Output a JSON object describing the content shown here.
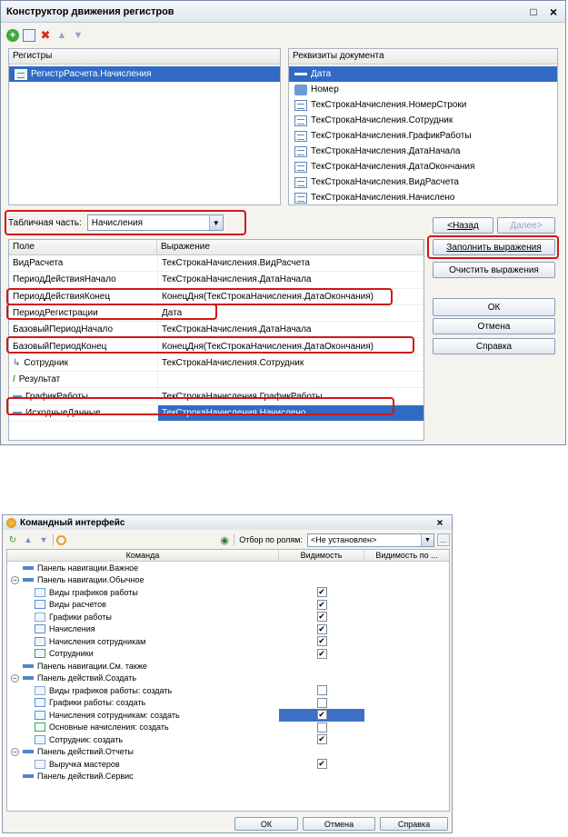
{
  "w1": {
    "title": "Конструктор движения регистров",
    "close_glyph": "×",
    "max_glyph": "□",
    "registers": {
      "header": "Регистры",
      "items": [
        "РегистрРасчета.Начисления"
      ]
    },
    "doc_props": {
      "header": "Реквизиты документа",
      "items": [
        "Дата",
        "Номер",
        "ТекСтрокаНачисления.НомерСтроки",
        "ТекСтрокаНачисления.Сотрудник",
        "ТекСтрокаНачисления.ГрафикРаботы",
        "ТекСтрокаНачисления.ДатаНачала",
        "ТекСтрокаНачисления.ДатаОкончания",
        "ТекСтрокаНачисления.ВидРасчета",
        "ТекСтрокаНачисления.Начислено"
      ]
    },
    "table_part": {
      "label": "Табличная часть:",
      "value": "Начисления"
    },
    "grid": {
      "col_field": "Поле",
      "col_expr": "Выражение",
      "rows": [
        {
          "field": "ВидРасчета",
          "expr": "ТекСтрокаНачисления.ВидРасчета"
        },
        {
          "field": "ПериодДействияНачало",
          "expr": "ТекСтрокаНачисления.ДатаНачала"
        },
        {
          "field": "ПериодДействияКонец",
          "expr": "КонецДня(ТекСтрокаНачисления.ДатаОкончания)"
        },
        {
          "field": "ПериодРегистрации",
          "expr": "Дата"
        },
        {
          "field": "БазовыйПериодНачало",
          "expr": "ТекСтрокаНачисления.ДатаНачала"
        },
        {
          "field": "БазовыйПериодКонец",
          "expr": "КонецДня(ТекСтрокаНачисления.ДатаОкончания)"
        },
        {
          "field": "Сотрудник",
          "expr": "ТекСтрокаНачисления.Сотрудник"
        },
        {
          "field": "Результат",
          "expr": ""
        },
        {
          "field": "ГрафикРаботы",
          "expr": "ТекСтрокаНачисления.ГрафикРаботы"
        },
        {
          "field": "ИсходныеДанные",
          "expr": "ТекСтрокаНачисления.Начислено"
        }
      ]
    },
    "buttons": {
      "back": "<Назад",
      "next": "Далее>",
      "fill": "Заполнить выражения",
      "clear": "Очистить выражения",
      "ok": "ОК",
      "cancel": "Отмена",
      "help": "Справка"
    }
  },
  "w2": {
    "title": "Командный интерфейс",
    "close_glyph": "×",
    "filter_label": "Отбор по ролям:",
    "filter_value": "<Не установлен>",
    "ellipsis": "...",
    "cols": {
      "command": "Команда",
      "visibility": "Видимость",
      "visibility_by": "Видимость по ..."
    },
    "rows": [
      {
        "label": "Панель навигации.Важное",
        "level": 0,
        "toggle": "",
        "check": null
      },
      {
        "label": "Панель навигации.Обычное",
        "level": 0,
        "toggle": "−",
        "check": null
      },
      {
        "label": "Виды графиков работы",
        "level": 1,
        "toggle": "",
        "check": true
      },
      {
        "label": "Виды расчетов",
        "level": 1,
        "toggle": "",
        "check": true
      },
      {
        "label": "Графики работы",
        "level": 1,
        "toggle": "",
        "check": true
      },
      {
        "label": "Начисления",
        "level": 1,
        "toggle": "",
        "check": true
      },
      {
        "label": "Начисления сотрудникам",
        "level": 1,
        "toggle": "",
        "check": true
      },
      {
        "label": "Сотрудники",
        "level": 1,
        "toggle": "",
        "check": true
      },
      {
        "label": "Панель навигации.См. также",
        "level": 0,
        "toggle": "",
        "check": null
      },
      {
        "label": "Панель действий.Создать",
        "level": 0,
        "toggle": "−",
        "check": null
      },
      {
        "label": "Виды графиков работы: создать",
        "level": 1,
        "toggle": "",
        "check": false
      },
      {
        "label": "Графики работы: создать",
        "level": 1,
        "toggle": "",
        "check": false
      },
      {
        "label": "Начисления сотрудникам: создать",
        "level": 1,
        "toggle": "",
        "check": true,
        "selected": true
      },
      {
        "label": "Основные начисления: создать",
        "level": 1,
        "toggle": "",
        "check": false
      },
      {
        "label": "Сотрудник: создать",
        "level": 1,
        "toggle": "",
        "check": true
      },
      {
        "label": "Панель действий.Отчеты",
        "level": 0,
        "toggle": "−",
        "check": null
      },
      {
        "label": "Выручка мастеров",
        "level": 1,
        "toggle": "",
        "check": true
      },
      {
        "label": "Панель действий.Сервис",
        "level": 0,
        "toggle": "",
        "check": null
      }
    ],
    "check_glyph": "✔",
    "buttons": {
      "ok": "ОК",
      "cancel": "Отмена",
      "help": "Справка"
    }
  }
}
